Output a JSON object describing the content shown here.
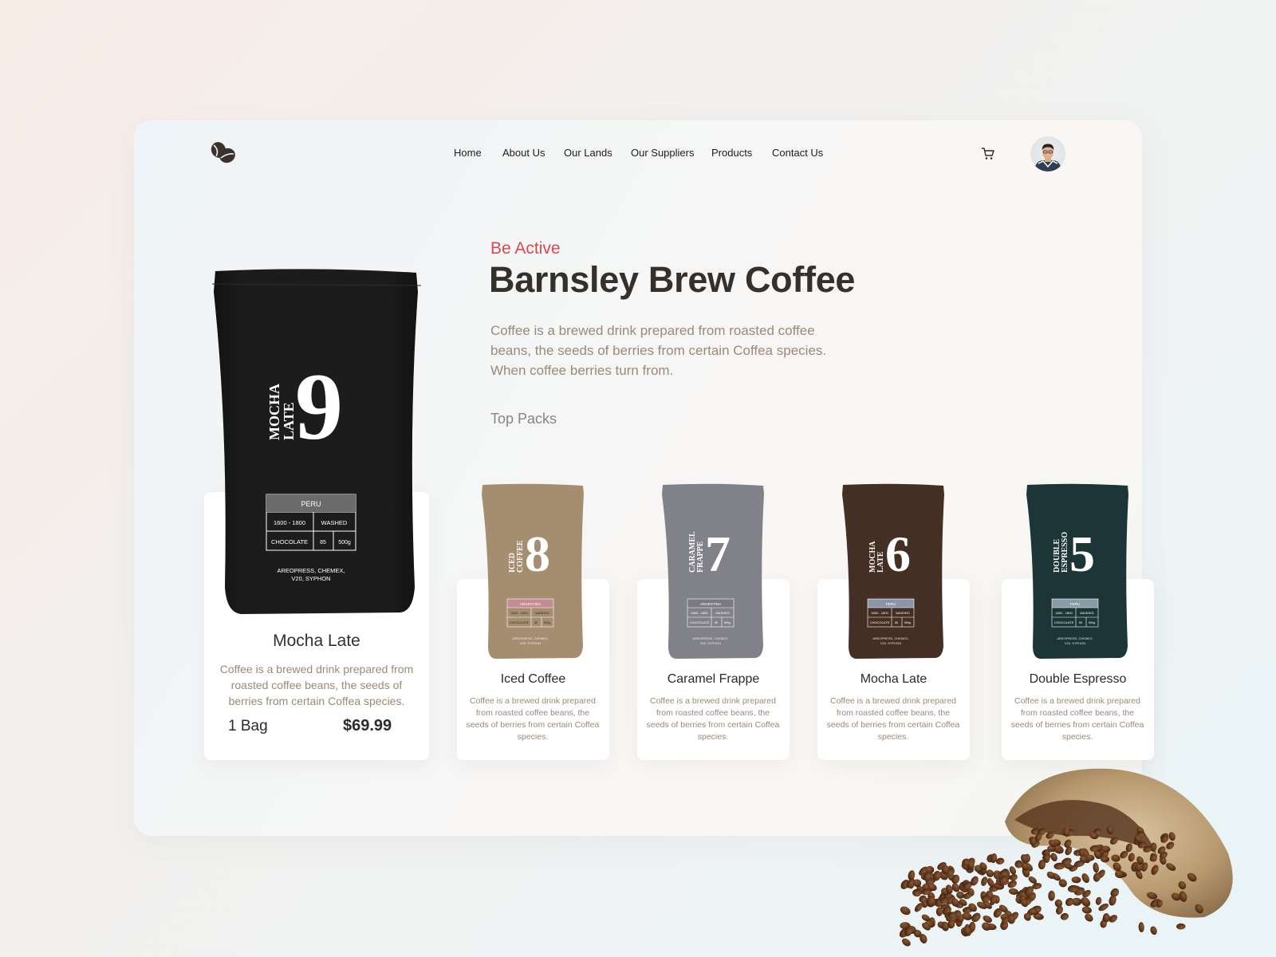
{
  "nav": {
    "items": [
      {
        "label": "Home"
      },
      {
        "label": "About Us"
      },
      {
        "label": "Our Lands"
      },
      {
        "label": "Our Suppliers"
      },
      {
        "label": "Products"
      },
      {
        "label": "Contact Us"
      }
    ],
    "logo_icon": "coffee-beans-icon",
    "cart_icon": "cart-icon"
  },
  "hero": {
    "eyebrow": "Be Active",
    "title": "Barnsley Brew Coffee",
    "description": "Coffee is a brewed drink prepared from roasted coffee beans, the seeds of berries from certain Coffea species. When coffee berries turn from.",
    "section_label": "Top Packs"
  },
  "featured": {
    "name": "Mocha Late",
    "description": "Coffee is a brewed drink prepared from roasted coffee beans, the seeds of berries from certain Coffea species.",
    "quantity": "1 Bag",
    "price": "$69.99",
    "bag": {
      "number": "9",
      "vertical_line1": "MOCHA",
      "vertical_line2": "LATE",
      "origin": "PERU",
      "altitude": "1600 - 1800",
      "process": "WASHED",
      "flavor": "CHOCOLATE",
      "score": "85",
      "weight": "500g",
      "brew_line1": "AREOPRESS, CHEMEX,",
      "brew_line2": "V20, SYPHON",
      "color": "#1c1c1c"
    }
  },
  "packs": [
    {
      "name": "Iced Coffee",
      "description": "Coffee is a brewed drink prepared from roasted coffee beans, the seeds of berries from certain Coffea species.",
      "bag": {
        "number": "8",
        "line1": "ICED",
        "line2": "COFFEE",
        "origin": "ARGENTINA",
        "altitude": "1800 - 1800",
        "process": "WASHED",
        "flavor": "CHOCOLATE",
        "score": "85",
        "weight": "500g",
        "brew_line1": "AREOPRESS, CHEMEX,",
        "brew_line2": "V20, SYPHON",
        "color": "#b49a7a",
        "label_color": "#c48a97"
      }
    },
    {
      "name": "Caramel Frappe",
      "description": "Coffee is a brewed drink prepared from roasted coffee beans, the seeds of berries from certain Coffea species.",
      "bag": {
        "number": "7",
        "line1": "CARAMEL",
        "line2": "FRAPPE",
        "origin": "ARGENTINA",
        "altitude": "1800 - 1800",
        "process": "WASHED",
        "flavor": "CHOCOLATE",
        "score": "85",
        "weight": "500g",
        "brew_line1": "AREOPRESS, CHEMEX,",
        "brew_line2": "V20, SYPHON",
        "color": "#8d8c95",
        "label_color": "#7a7a80"
      }
    },
    {
      "name": "Mocha Late",
      "description": "Coffee is a brewed drink prepared from roasted coffee beans, the seeds of berries from certain Coffea species.",
      "bag": {
        "number": "6",
        "line1": "MOCHA",
        "line2": "LATE",
        "origin": "PERU",
        "altitude": "1800 - 1800",
        "process": "WASHED",
        "flavor": "CHOCOLATE",
        "score": "85",
        "weight": "500g",
        "brew_line1": "AREOPRESS, CHEMEX,",
        "brew_line2": "V20, SYPHON",
        "color": "#4a3328",
        "label_color": "#8a96a8"
      }
    },
    {
      "name": "Double Espresso",
      "description": "Coffee is a brewed drink prepared from roasted coffee beans, the seeds of berries from certain Coffea species.",
      "bag": {
        "number": "5",
        "line1": "DOUBLE",
        "line2": "ESPRESSO",
        "origin": "PERU",
        "altitude": "1800 - 1800",
        "process": "WASHED",
        "flavor": "CHOCOLATE",
        "score": "85",
        "weight": "500g",
        "brew_line1": "AREOPRESS, CHEMEX,",
        "brew_line2": "V20, SYPHON",
        "color": "#1f3a3b",
        "label_color": "#8a9ba8"
      }
    }
  ],
  "colors": {
    "accent": "#e0474c",
    "title": "#35302c",
    "muted": "#9a8a78"
  }
}
